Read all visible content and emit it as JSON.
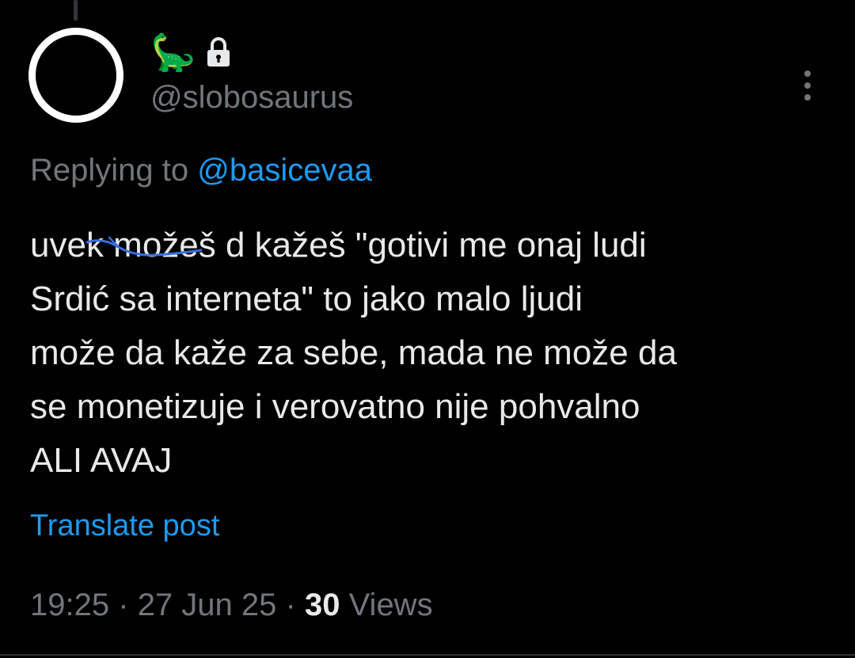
{
  "author": {
    "display_name_emoji": "🦕",
    "handle": "@slobosaurus",
    "protected_icon": "lock-icon"
  },
  "reply": {
    "prefix": "Replying to",
    "to_handle": "@basicevaa"
  },
  "post": {
    "lines": [
      "uvek možeš d kažeš \"gotivi me onaj ludi",
      "Srdić sa interneta\" to jako malo ljudi",
      "može da kaže za sebe, mada ne može da",
      "se monetizuje i verovatno nije pohvalno",
      "ALI AVAJ"
    ]
  },
  "translate_label": "Translate post",
  "meta": {
    "time": "19:25",
    "date": "27 Jun 25",
    "separator": "·",
    "views_count": "30",
    "views_label": "Views"
  },
  "colors": {
    "background": "#000000",
    "text_primary": "#e7e9ea",
    "text_secondary": "#71767b",
    "link": "#1d9bf0",
    "scribble": "#3a6de0"
  },
  "icons": {
    "more": "more-vertical-icon",
    "lock": "lock-icon",
    "avatar": "avatar"
  }
}
